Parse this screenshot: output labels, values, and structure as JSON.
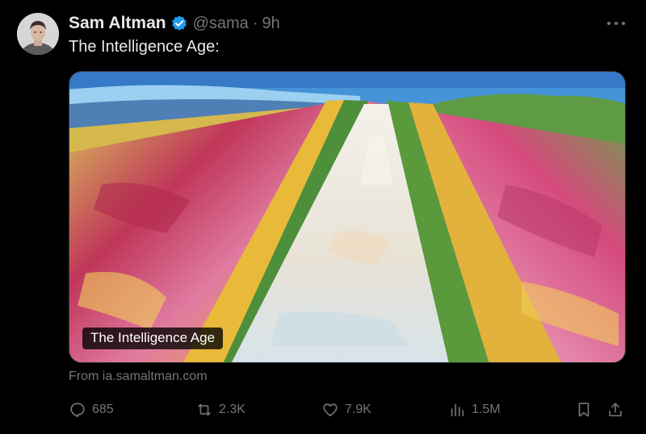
{
  "author": {
    "display_name": "Sam Altman",
    "handle": "@sama",
    "separator": "·",
    "time": "9h",
    "verified": true
  },
  "tweet": {
    "text": "The Intelligence Age:"
  },
  "card": {
    "title": "The Intelligence Age",
    "source": "From ia.samaltman.com"
  },
  "actions": {
    "replies": "685",
    "reposts": "2.3K",
    "likes": "7.9K",
    "views": "1.5M"
  },
  "icons": {
    "verified": "verified-badge-icon",
    "more": "more-icon",
    "reply": "reply-icon",
    "repost": "repost-icon",
    "like": "heart-icon",
    "views": "views-icon",
    "bookmark": "bookmark-icon",
    "share": "share-icon"
  },
  "colors": {
    "background": "#000000",
    "text_primary": "#e7e9ea",
    "text_secondary": "#71767b",
    "verified_blue": "#1d9bf0"
  }
}
